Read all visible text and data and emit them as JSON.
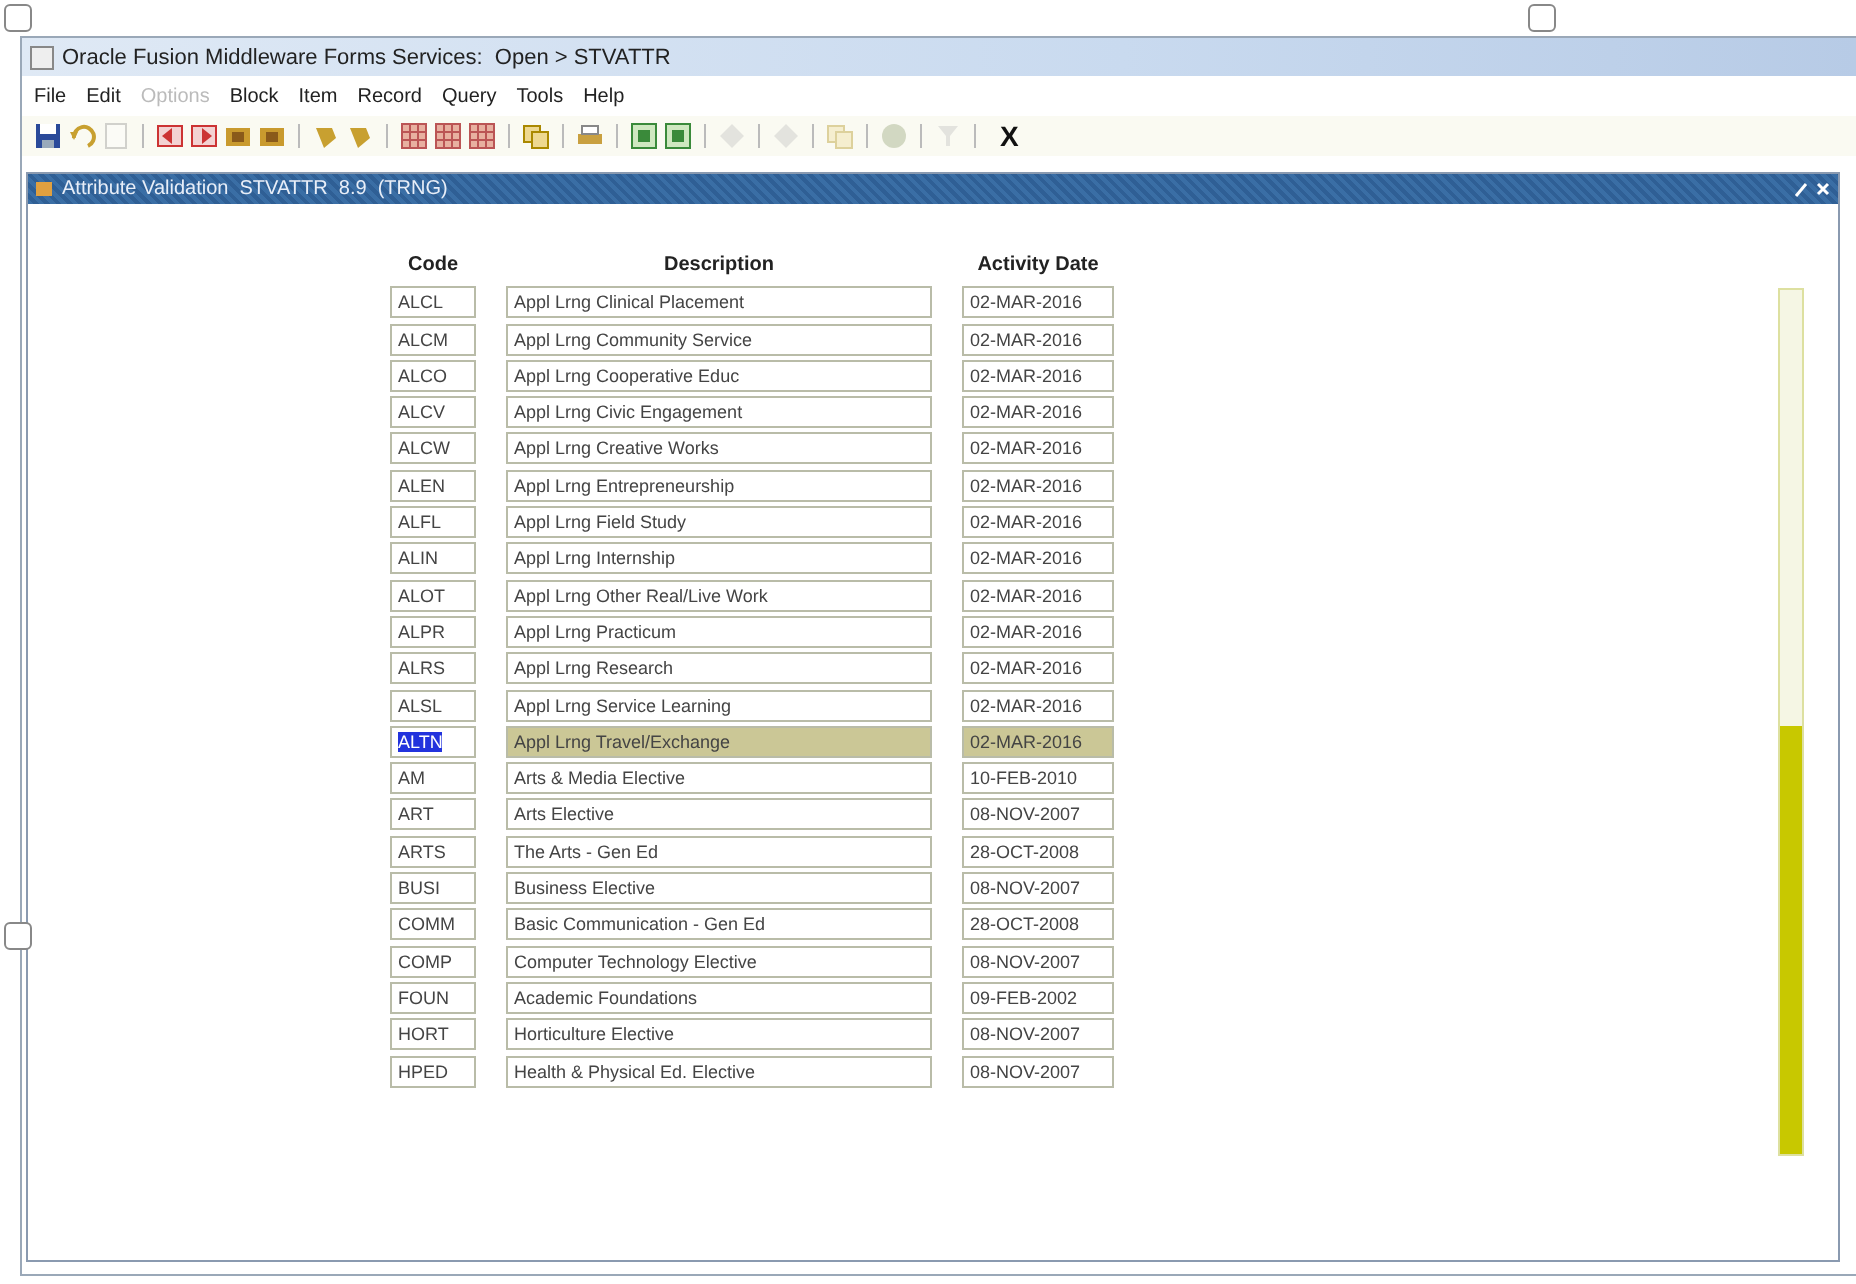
{
  "window": {
    "title": "Oracle Fusion Middleware Forms Services:  Open > STVATTR"
  },
  "menu": [
    {
      "label": "File",
      "disabled": false
    },
    {
      "label": "Edit",
      "disabled": false
    },
    {
      "label": "Options",
      "disabled": true
    },
    {
      "label": "Block",
      "disabled": false
    },
    {
      "label": "Item",
      "disabled": false
    },
    {
      "label": "Record",
      "disabled": false
    },
    {
      "label": "Query",
      "disabled": false
    },
    {
      "label": "Tools",
      "disabled": false
    },
    {
      "label": "Help",
      "disabled": false
    }
  ],
  "toolbar": [
    {
      "kind": "disk",
      "disabled": false
    },
    {
      "kind": "undo",
      "disabled": false
    },
    {
      "kind": "page",
      "disabled": true
    },
    {
      "kind": "sep"
    },
    {
      "kind": "red-left",
      "disabled": false
    },
    {
      "kind": "red-right",
      "disabled": false
    },
    {
      "kind": "folder",
      "disabled": false
    },
    {
      "kind": "folder",
      "disabled": false
    },
    {
      "kind": "sep"
    },
    {
      "kind": "hand",
      "disabled": false
    },
    {
      "kind": "hand",
      "disabled": false
    },
    {
      "kind": "sep"
    },
    {
      "kind": "grid",
      "disabled": false
    },
    {
      "kind": "grid",
      "disabled": false
    },
    {
      "kind": "grid",
      "disabled": false
    },
    {
      "kind": "sep"
    },
    {
      "kind": "stack",
      "disabled": false
    },
    {
      "kind": "sep"
    },
    {
      "kind": "printer",
      "disabled": false
    },
    {
      "kind": "sep"
    },
    {
      "kind": "green",
      "disabled": false
    },
    {
      "kind": "green",
      "disabled": false
    },
    {
      "kind": "sep"
    },
    {
      "kind": "diamond",
      "disabled": true
    },
    {
      "kind": "sep"
    },
    {
      "kind": "diamond",
      "disabled": true
    },
    {
      "kind": "sep"
    },
    {
      "kind": "stack",
      "disabled": true
    },
    {
      "kind": "sep"
    },
    {
      "kind": "globe",
      "disabled": true
    },
    {
      "kind": "sep"
    },
    {
      "kind": "funnel",
      "disabled": true
    },
    {
      "kind": "sep"
    },
    {
      "kind": "text",
      "label": "X",
      "disabled": false
    }
  ],
  "form": {
    "title": "Attribute Validation  STVATTR  8.9  (TRNG)",
    "columns": [
      "Code",
      "Description",
      "Activity Date"
    ],
    "rows": [
      {
        "code": "ALCL",
        "description": "Appl Lrng Clinical Placement",
        "activity_date": "02-MAR-2016",
        "selected": false
      },
      {
        "code": "ALCM",
        "description": "Appl Lrng Community Service",
        "activity_date": "02-MAR-2016",
        "selected": false
      },
      {
        "code": "ALCO",
        "description": "Appl Lrng Cooperative Educ",
        "activity_date": "02-MAR-2016",
        "selected": false
      },
      {
        "code": "ALCV",
        "description": "Appl Lrng Civic Engagement",
        "activity_date": "02-MAR-2016",
        "selected": false
      },
      {
        "code": "ALCW",
        "description": "Appl Lrng Creative Works",
        "activity_date": "02-MAR-2016",
        "selected": false
      },
      {
        "code": "ALEN",
        "description": "Appl Lrng Entrepreneurship",
        "activity_date": "02-MAR-2016",
        "selected": false
      },
      {
        "code": "ALFL",
        "description": "Appl Lrng Field Study",
        "activity_date": "02-MAR-2016",
        "selected": false
      },
      {
        "code": "ALIN",
        "description": "Appl Lrng Internship",
        "activity_date": "02-MAR-2016",
        "selected": false
      },
      {
        "code": "ALOT",
        "description": "Appl Lrng Other Real/Live Work",
        "activity_date": "02-MAR-2016",
        "selected": false
      },
      {
        "code": "ALPR",
        "description": "Appl Lrng Practicum",
        "activity_date": "02-MAR-2016",
        "selected": false
      },
      {
        "code": "ALRS",
        "description": "Appl Lrng Research",
        "activity_date": "02-MAR-2016",
        "selected": false
      },
      {
        "code": "ALSL",
        "description": "Appl Lrng Service Learning",
        "activity_date": "02-MAR-2016",
        "selected": false
      },
      {
        "code": "ALTN",
        "description": "Appl Lrng Travel/Exchange",
        "activity_date": "02-MAR-2016",
        "selected": true
      },
      {
        "code": "AM",
        "description": "Arts & Media Elective",
        "activity_date": "10-FEB-2010",
        "selected": false
      },
      {
        "code": "ART",
        "description": "Arts Elective",
        "activity_date": "08-NOV-2007",
        "selected": false
      },
      {
        "code": "ARTS",
        "description": "The Arts - Gen Ed",
        "activity_date": "28-OCT-2008",
        "selected": false
      },
      {
        "code": "BUSI",
        "description": "Business Elective",
        "activity_date": "08-NOV-2007",
        "selected": false
      },
      {
        "code": "COMM",
        "description": "Basic Communication - Gen Ed",
        "activity_date": "28-OCT-2008",
        "selected": false
      },
      {
        "code": "COMP",
        "description": "Computer Technology Elective",
        "activity_date": "08-NOV-2007",
        "selected": false
      },
      {
        "code": "FOUN",
        "description": "Academic Foundations",
        "activity_date": "09-FEB-2002",
        "selected": false
      },
      {
        "code": "HORT",
        "description": "Horticulture Elective",
        "activity_date": "08-NOV-2007",
        "selected": false
      },
      {
        "code": "HPED",
        "description": "Health & Physical Ed. Elective",
        "activity_date": "08-NOV-2007",
        "selected": false
      }
    ]
  }
}
